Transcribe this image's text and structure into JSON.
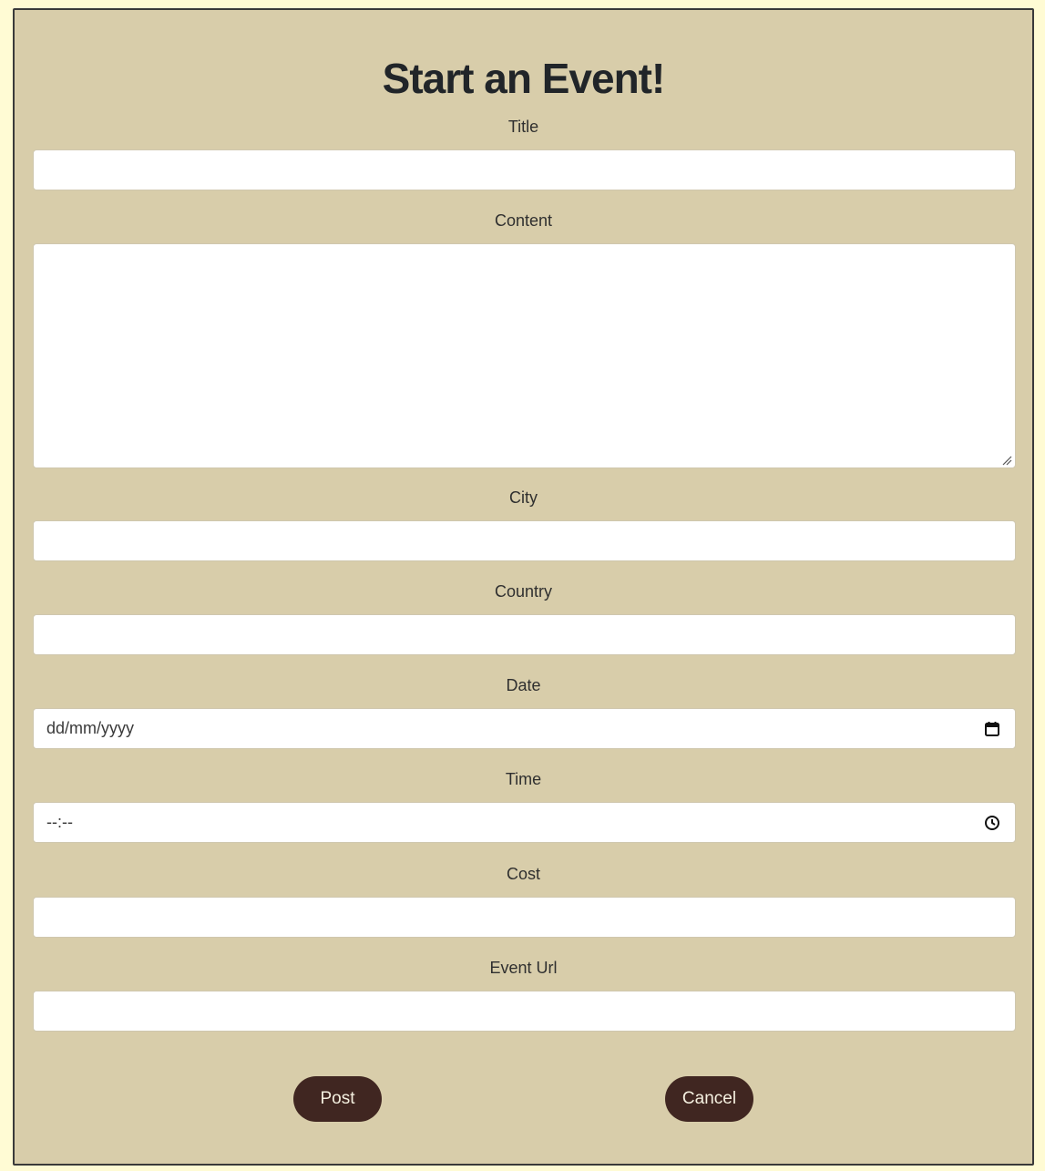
{
  "form": {
    "title": "Start an Event!",
    "fields": {
      "title": {
        "label": "Title",
        "value": ""
      },
      "content": {
        "label": "Content",
        "value": ""
      },
      "city": {
        "label": "City",
        "value": ""
      },
      "country": {
        "label": "Country",
        "value": ""
      },
      "date": {
        "label": "Date",
        "placeholder": "dd/mm/yyyy",
        "icon": "calendar-icon"
      },
      "time": {
        "label": "Time",
        "placeholder": "--:--",
        "icon": "clock-icon"
      },
      "cost": {
        "label": "Cost",
        "value": ""
      },
      "event_url": {
        "label": "Event Url",
        "value": ""
      }
    },
    "buttons": {
      "post": "Post",
      "cancel": "Cancel"
    }
  },
  "colors": {
    "page_background": "#fffbd4",
    "card_background": "#d8cdaa",
    "button_background": "#402621",
    "button_text": "#f5f0e0"
  }
}
